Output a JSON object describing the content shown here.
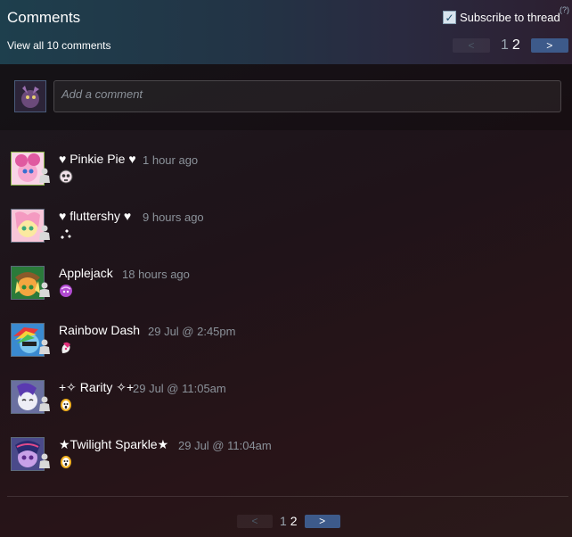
{
  "header": {
    "title": "Comments",
    "view_all": "View all 10 comments",
    "subscribe_label": "Subscribe to thread",
    "subscribe_checked": true,
    "help": "(?)"
  },
  "pager": {
    "prev": "<",
    "next": ">",
    "page_1": "1",
    "page_2": "2",
    "current_page": 2
  },
  "composer": {
    "placeholder": "Add a comment"
  },
  "comments": [
    {
      "name": "♥ Pinkie Pie ♥",
      "time": "1 hour ago",
      "online": true,
      "avatar_color": "#f7a8d0",
      "emote": "skull-emoticon"
    },
    {
      "name": "♥ fluttershy ♥",
      "time": "9 hours ago",
      "online": false,
      "avatar_color": "#fbe9a0",
      "emote": "sparkle-emoticon"
    },
    {
      "name": "Applejack",
      "time": "18 hours ago",
      "online": false,
      "avatar_color": "#f4a640",
      "emote": "purple-pony-emoticon"
    },
    {
      "name": "Rainbow Dash",
      "time": "29 Jul @ 2:45pm",
      "online": false,
      "avatar_color": "#7ec8f0",
      "emote": "pink-pony-emoticon"
    },
    {
      "name": "+✧ Rarity ✧+",
      "time": "29 Jul @ 11:05am",
      "online": false,
      "avatar_color": "#e8e8f2",
      "emote": "ghost-face-emoticon"
    },
    {
      "name": "★Twilight Sparkle★",
      "time": "29 Jul @ 11:04am",
      "online": false,
      "avatar_color": "#b48ad6",
      "emote": "ghost-face-emoticon"
    }
  ]
}
